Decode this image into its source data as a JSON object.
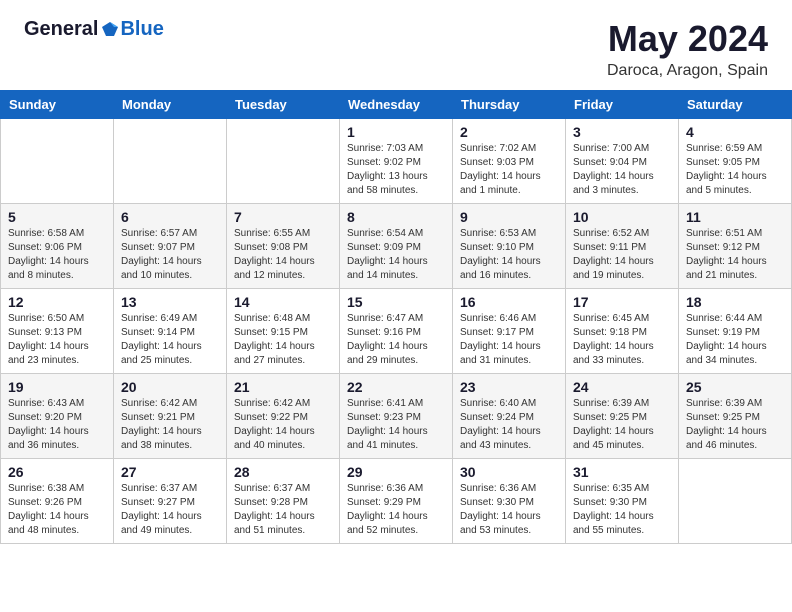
{
  "header": {
    "logo_general": "General",
    "logo_blue": "Blue",
    "month_year": "May 2024",
    "location": "Daroca, Aragon, Spain"
  },
  "days_of_week": [
    "Sunday",
    "Monday",
    "Tuesday",
    "Wednesday",
    "Thursday",
    "Friday",
    "Saturday"
  ],
  "weeks": [
    [
      {
        "day": "",
        "info": ""
      },
      {
        "day": "",
        "info": ""
      },
      {
        "day": "",
        "info": ""
      },
      {
        "day": "1",
        "info": "Sunrise: 7:03 AM\nSunset: 9:02 PM\nDaylight: 13 hours and 58 minutes."
      },
      {
        "day": "2",
        "info": "Sunrise: 7:02 AM\nSunset: 9:03 PM\nDaylight: 14 hours and 1 minute."
      },
      {
        "day": "3",
        "info": "Sunrise: 7:00 AM\nSunset: 9:04 PM\nDaylight: 14 hours and 3 minutes."
      },
      {
        "day": "4",
        "info": "Sunrise: 6:59 AM\nSunset: 9:05 PM\nDaylight: 14 hours and 5 minutes."
      }
    ],
    [
      {
        "day": "5",
        "info": "Sunrise: 6:58 AM\nSunset: 9:06 PM\nDaylight: 14 hours and 8 minutes."
      },
      {
        "day": "6",
        "info": "Sunrise: 6:57 AM\nSunset: 9:07 PM\nDaylight: 14 hours and 10 minutes."
      },
      {
        "day": "7",
        "info": "Sunrise: 6:55 AM\nSunset: 9:08 PM\nDaylight: 14 hours and 12 minutes."
      },
      {
        "day": "8",
        "info": "Sunrise: 6:54 AM\nSunset: 9:09 PM\nDaylight: 14 hours and 14 minutes."
      },
      {
        "day": "9",
        "info": "Sunrise: 6:53 AM\nSunset: 9:10 PM\nDaylight: 14 hours and 16 minutes."
      },
      {
        "day": "10",
        "info": "Sunrise: 6:52 AM\nSunset: 9:11 PM\nDaylight: 14 hours and 19 minutes."
      },
      {
        "day": "11",
        "info": "Sunrise: 6:51 AM\nSunset: 9:12 PM\nDaylight: 14 hours and 21 minutes."
      }
    ],
    [
      {
        "day": "12",
        "info": "Sunrise: 6:50 AM\nSunset: 9:13 PM\nDaylight: 14 hours and 23 minutes."
      },
      {
        "day": "13",
        "info": "Sunrise: 6:49 AM\nSunset: 9:14 PM\nDaylight: 14 hours and 25 minutes."
      },
      {
        "day": "14",
        "info": "Sunrise: 6:48 AM\nSunset: 9:15 PM\nDaylight: 14 hours and 27 minutes."
      },
      {
        "day": "15",
        "info": "Sunrise: 6:47 AM\nSunset: 9:16 PM\nDaylight: 14 hours and 29 minutes."
      },
      {
        "day": "16",
        "info": "Sunrise: 6:46 AM\nSunset: 9:17 PM\nDaylight: 14 hours and 31 minutes."
      },
      {
        "day": "17",
        "info": "Sunrise: 6:45 AM\nSunset: 9:18 PM\nDaylight: 14 hours and 33 minutes."
      },
      {
        "day": "18",
        "info": "Sunrise: 6:44 AM\nSunset: 9:19 PM\nDaylight: 14 hours and 34 minutes."
      }
    ],
    [
      {
        "day": "19",
        "info": "Sunrise: 6:43 AM\nSunset: 9:20 PM\nDaylight: 14 hours and 36 minutes."
      },
      {
        "day": "20",
        "info": "Sunrise: 6:42 AM\nSunset: 9:21 PM\nDaylight: 14 hours and 38 minutes."
      },
      {
        "day": "21",
        "info": "Sunrise: 6:42 AM\nSunset: 9:22 PM\nDaylight: 14 hours and 40 minutes."
      },
      {
        "day": "22",
        "info": "Sunrise: 6:41 AM\nSunset: 9:23 PM\nDaylight: 14 hours and 41 minutes."
      },
      {
        "day": "23",
        "info": "Sunrise: 6:40 AM\nSunset: 9:24 PM\nDaylight: 14 hours and 43 minutes."
      },
      {
        "day": "24",
        "info": "Sunrise: 6:39 AM\nSunset: 9:25 PM\nDaylight: 14 hours and 45 minutes."
      },
      {
        "day": "25",
        "info": "Sunrise: 6:39 AM\nSunset: 9:25 PM\nDaylight: 14 hours and 46 minutes."
      }
    ],
    [
      {
        "day": "26",
        "info": "Sunrise: 6:38 AM\nSunset: 9:26 PM\nDaylight: 14 hours and 48 minutes."
      },
      {
        "day": "27",
        "info": "Sunrise: 6:37 AM\nSunset: 9:27 PM\nDaylight: 14 hours and 49 minutes."
      },
      {
        "day": "28",
        "info": "Sunrise: 6:37 AM\nSunset: 9:28 PM\nDaylight: 14 hours and 51 minutes."
      },
      {
        "day": "29",
        "info": "Sunrise: 6:36 AM\nSunset: 9:29 PM\nDaylight: 14 hours and 52 minutes."
      },
      {
        "day": "30",
        "info": "Sunrise: 6:36 AM\nSunset: 9:30 PM\nDaylight: 14 hours and 53 minutes."
      },
      {
        "day": "31",
        "info": "Sunrise: 6:35 AM\nSunset: 9:30 PM\nDaylight: 14 hours and 55 minutes."
      },
      {
        "day": "",
        "info": ""
      }
    ]
  ]
}
